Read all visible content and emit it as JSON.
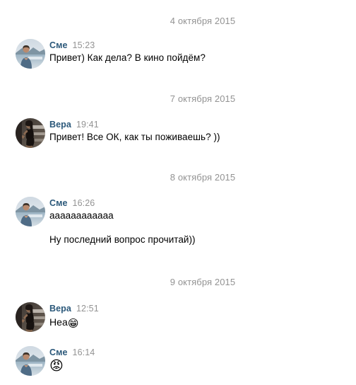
{
  "app": {
    "kind": "messenger-conversation",
    "background_color": "#ffffff",
    "author_color": "#2b587a",
    "meta_color": "#939393",
    "text_color": "#000000"
  },
  "conversation": [
    {
      "type": "date",
      "label": "4 октября 2015"
    },
    {
      "type": "message",
      "author": "Сме",
      "time": "15:23",
      "avatar": "avatar-man-lake",
      "lines": [
        {
          "kind": "text",
          "text": "Привет) Как дела? В кино пойдём?"
        }
      ]
    },
    {
      "type": "date",
      "label": "7 октября 2015"
    },
    {
      "type": "message",
      "author": "Вера",
      "time": "19:41",
      "avatar": "avatar-woman-dark-dress",
      "lines": [
        {
          "kind": "text",
          "text": "Привет! Все ОК, как ты поживаешь? ))"
        }
      ]
    },
    {
      "type": "date",
      "label": "8 октября 2015"
    },
    {
      "type": "message",
      "author": "Сме",
      "time": "16:26",
      "avatar": "avatar-man-lake",
      "lines": [
        {
          "kind": "text",
          "text": "aaaaaaaaaaaa"
        },
        {
          "kind": "text",
          "text": "Ну последний вопрос прочитай))"
        }
      ]
    },
    {
      "type": "date",
      "label": "9 октября 2015"
    },
    {
      "type": "message",
      "author": "Вера",
      "time": "12:51",
      "avatar": "avatar-woman-dark-dress",
      "lines": [
        {
          "kind": "text-emoji",
          "text": "Неа",
          "emoji": "😁",
          "emoji_name": "grinning-face-with-smiling-eyes-emoji"
        }
      ]
    },
    {
      "type": "message",
      "author": "Сме",
      "time": "16:14",
      "avatar": "avatar-man-lake",
      "lines": [
        {
          "kind": "emoji-only",
          "emoji": "😡",
          "emoji_name": "pouting-angry-face-emoji"
        }
      ]
    }
  ]
}
